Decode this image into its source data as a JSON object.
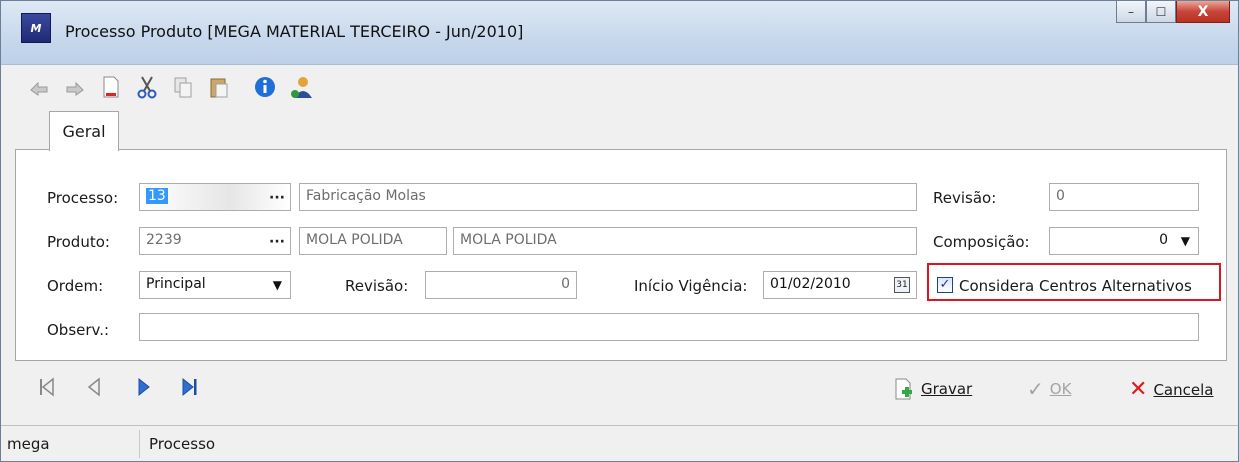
{
  "window": {
    "title": "Processo Produto [MEGA MATERIAL TERCEIRO - Jun/2010]",
    "logo_text": "M",
    "buttons": {
      "minimize": "–",
      "maximize": "☐",
      "close": "X"
    }
  },
  "toolbar": {
    "icons": [
      "undo-icon",
      "redo-icon",
      "new-document-icon",
      "cut-icon",
      "copy-icon",
      "paste-icon",
      "info-icon",
      "user-icon"
    ]
  },
  "tabs": [
    {
      "label": "Geral"
    }
  ],
  "form": {
    "processo": {
      "label": "Processo:",
      "code": "13",
      "description": "Fabricação Molas"
    },
    "revisao_top": {
      "label": "Revisão:",
      "value": "0"
    },
    "produto": {
      "label": "Produto:",
      "code": "2239",
      "desc1": "MOLA POLIDA",
      "desc2": "MOLA POLIDA"
    },
    "composicao": {
      "label": "Composição:",
      "value": "0"
    },
    "ordem": {
      "label": "Ordem:",
      "value": "Principal"
    },
    "revisao_mid": {
      "label": "Revisão:",
      "value": "0"
    },
    "inicio_vigencia": {
      "label": "Início Vigência:",
      "value": "01/02/2010"
    },
    "considera": {
      "label": "Considera Centros Alternativos",
      "checked": true
    },
    "observ": {
      "label": "Observ.:",
      "value": ""
    }
  },
  "actions": {
    "gravar": "Gravar",
    "ok": "OK",
    "cancela": "Cancela"
  },
  "status": {
    "user": "mega",
    "module": "Processo"
  },
  "colors": {
    "highlight_border": "#e0141e",
    "selection": "#3399ff"
  }
}
